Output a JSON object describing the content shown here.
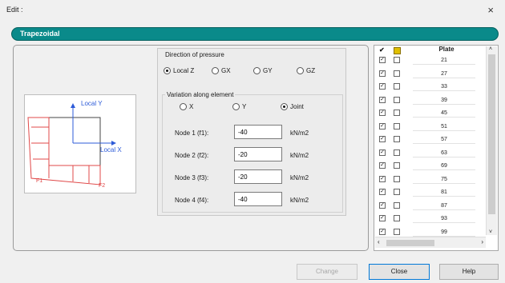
{
  "window": {
    "title": "Edit :",
    "close_glyph": "×"
  },
  "banner": {
    "label": "Trapezoidal",
    "color": "#0a8a8a"
  },
  "pressure": {
    "label": "Direction of pressure",
    "options": [
      "Local Z",
      "GX",
      "GY",
      "GZ"
    ],
    "selected": "Local Z"
  },
  "variation": {
    "label": "Variation along element",
    "options": [
      "X",
      "Y",
      "Joint"
    ],
    "selected": "Joint"
  },
  "nodes": [
    {
      "label": "Node 1 (f1):",
      "value": "-40",
      "unit": "kN/m2"
    },
    {
      "label": "Node 2 (f2):",
      "value": "-20",
      "unit": "kN/m2"
    },
    {
      "label": "Node 3 (f3):",
      "value": "-20",
      "unit": "kN/m2"
    },
    {
      "label": "Node 4 (f4):",
      "value": "-40",
      "unit": "kN/m2"
    }
  ],
  "diagram": {
    "local_y": "Local Y",
    "local_x": "Local X",
    "f1": "F1",
    "f2": "F2"
  },
  "table": {
    "check_header": "✔",
    "icon_header": "plate-icon",
    "plate_header": "Plate",
    "rows": [
      "21",
      "27",
      "33",
      "39",
      "45",
      "51",
      "57",
      "63",
      "69",
      "75",
      "81",
      "87",
      "93",
      "99"
    ]
  },
  "buttons": {
    "change": "Change",
    "close": "Close",
    "help": "Help"
  }
}
